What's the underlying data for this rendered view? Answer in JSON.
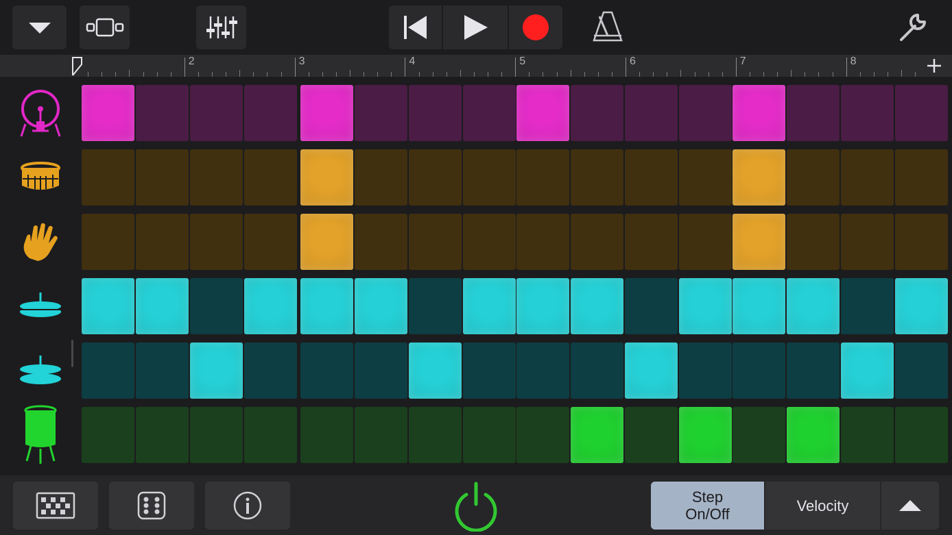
{
  "toolbar": {
    "icons": [
      "chevron-down-icon",
      "track-view-icon",
      "mixer-icon",
      "go-to-start-icon",
      "play-icon",
      "record-icon",
      "metronome-icon",
      "settings-wrench-icon"
    ],
    "record_color": "#ff1f1f"
  },
  "ruler": {
    "bars": [
      "",
      "2",
      "3",
      "4",
      "5",
      "6",
      "7",
      "8"
    ],
    "add_icon": "plus-icon"
  },
  "instruments": [
    {
      "name": "kick",
      "icon": "kick-drum-icon",
      "color": "#e227c7"
    },
    {
      "name": "snare",
      "icon": "snare-drum-icon",
      "color": "#e6a11e"
    },
    {
      "name": "clap",
      "icon": "clap-hand-icon",
      "color": "#e6a11e"
    },
    {
      "name": "closed-hihat",
      "icon": "hihat-closed-icon",
      "color": "#22d3d8"
    },
    {
      "name": "open-hihat",
      "icon": "hihat-open-icon",
      "color": "#22d3d8"
    },
    {
      "name": "tom",
      "icon": "tom-drum-icon",
      "color": "#22d52e"
    }
  ],
  "pattern": {
    "steps": 16,
    "rows": [
      {
        "on_color": "#e52cc9",
        "off_color": "#4b1c45",
        "steps": [
          1,
          0,
          0,
          0,
          1,
          0,
          0,
          0,
          1,
          0,
          0,
          0,
          1,
          0,
          0,
          0
        ]
      },
      {
        "on_color": "#e3a229",
        "off_color": "#41300f",
        "steps": [
          0,
          0,
          0,
          0,
          1,
          0,
          0,
          0,
          0,
          0,
          0,
          0,
          1,
          0,
          0,
          0
        ]
      },
      {
        "on_color": "#e3a229",
        "off_color": "#41300f",
        "steps": [
          0,
          0,
          0,
          0,
          1,
          0,
          0,
          0,
          0,
          0,
          0,
          0,
          1,
          0,
          0,
          0
        ]
      },
      {
        "on_color": "#25d1d6",
        "off_color": "#0d3e43",
        "steps": [
          1,
          1,
          0,
          1,
          1,
          1,
          0,
          1,
          1,
          1,
          0,
          1,
          1,
          1,
          0,
          1
        ]
      },
      {
        "on_color": "#25d1d6",
        "off_color": "#0d3e43",
        "steps": [
          0,
          0,
          1,
          0,
          0,
          0,
          1,
          0,
          0,
          0,
          1,
          0,
          0,
          0,
          1,
          0
        ]
      },
      {
        "on_color": "#1fd12f",
        "off_color": "#1b401d",
        "steps": [
          0,
          0,
          0,
          0,
          0,
          0,
          0,
          0,
          0,
          1,
          0,
          1,
          0,
          1,
          0,
          0
        ]
      }
    ]
  },
  "bottombar": {
    "icons": [
      "pattern-grid-icon",
      "dice-icon",
      "info-icon",
      "power-icon"
    ],
    "power_color": "#32c832",
    "mode_step": "Step\nOn/Off",
    "mode_velocity": "Velocity",
    "expand_icon": "chevron-up-icon",
    "selected_mode": "Step On/Off"
  }
}
